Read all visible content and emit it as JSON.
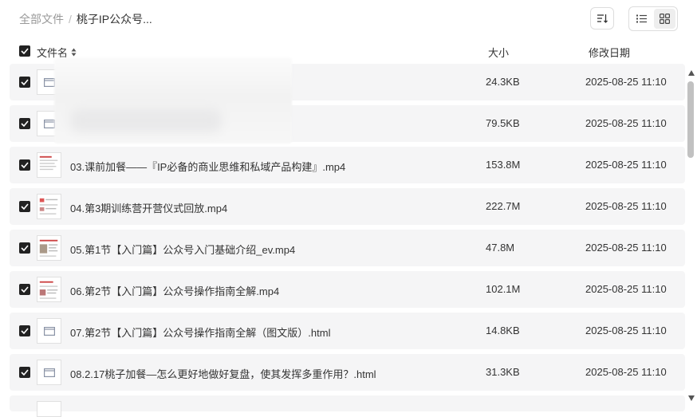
{
  "breadcrumb": {
    "root": "全部文件",
    "separator": "/",
    "current": "桃子IP公众号..."
  },
  "toolbar": {
    "sort_icon": "sort-desc-icon",
    "list_icon": "list-view-icon",
    "grid_icon": "grid-view-icon"
  },
  "columns": {
    "name": "文件名",
    "size": "大小",
    "date": "修改日期"
  },
  "files": [
    {
      "name": "",
      "size": "24.3KB",
      "date": "2025-08-25 11:10",
      "type": "html"
    },
    {
      "name": "",
      "size": "79.5KB",
      "date": "2025-08-25 11:10",
      "type": "html"
    },
    {
      "name": "03.课前加餐——『IP必备的商业思维和私域产品构建』.mp4",
      "size": "153.8M",
      "date": "2025-08-25 11:10",
      "type": "video"
    },
    {
      "name": "04.第3期训练营开营仪式回放.mp4",
      "size": "222.7M",
      "date": "2025-08-25 11:10",
      "type": "video"
    },
    {
      "name": "05.第1节【入门篇】公众号入门基础介绍_ev.mp4",
      "size": "47.8M",
      "date": "2025-08-25 11:10",
      "type": "video"
    },
    {
      "name": "06.第2节【入门篇】公众号操作指南全解.mp4",
      "size": "102.1M",
      "date": "2025-08-25 11:10",
      "type": "video"
    },
    {
      "name": "07.第2节【入门篇】公众号操作指南全解（图文版）.html",
      "size": "14.8KB",
      "date": "2025-08-25 11:10",
      "type": "html"
    },
    {
      "name": "08.2.17桃子加餐—怎么更好地做好复盘，使其发挥多重作用？.html",
      "size": "31.3KB",
      "date": "2025-08-25 11:10",
      "type": "html"
    }
  ]
}
